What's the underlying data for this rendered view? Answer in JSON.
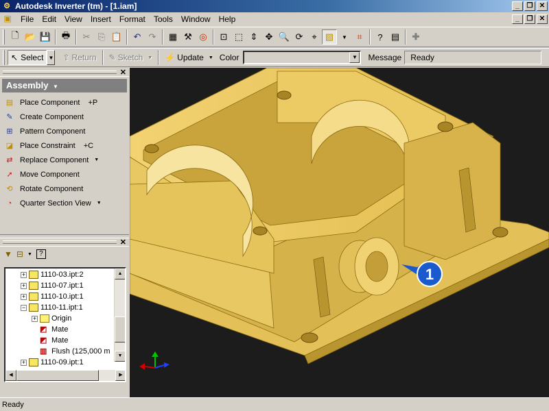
{
  "window": {
    "title": "Autodesk Inverter (tm) - [1.iam]",
    "min": "_",
    "max": "❐",
    "close": "✕"
  },
  "menu": [
    "File",
    "Edit",
    "View",
    "Insert",
    "Format",
    "Tools",
    "Window",
    "Help"
  ],
  "toolbar2": {
    "select": "Select",
    "return": "Return",
    "sketch": "Sketch",
    "update": "Update",
    "color_label": "Color",
    "color_value": "",
    "message_label": "Message",
    "message_value": "Ready"
  },
  "assembly_panel": {
    "title": "Assembly",
    "commands": [
      {
        "label": "Place Component",
        "shortcut": "+P"
      },
      {
        "label": "Create Component",
        "shortcut": ""
      },
      {
        "label": "Pattern Component",
        "shortcut": ""
      },
      {
        "label": "Place Constraint",
        "shortcut": "+C"
      },
      {
        "label": "Replace Component",
        "shortcut": ""
      },
      {
        "label": "Move Component",
        "shortcut": ""
      },
      {
        "label": "Rotate Component",
        "shortcut": ""
      },
      {
        "label": "Quarter Section View",
        "shortcut": ""
      }
    ]
  },
  "browser": {
    "tree": [
      {
        "label": "1110-03.ipt:2",
        "level": 0,
        "expander": "+",
        "icon": "part"
      },
      {
        "label": "1110-07.ipt:1",
        "level": 0,
        "expander": "+",
        "icon": "part"
      },
      {
        "label": "1110-10.ipt:1",
        "level": 0,
        "expander": "+",
        "icon": "part"
      },
      {
        "label": "1110-11.ipt:1",
        "level": 0,
        "expander": "−",
        "icon": "part"
      },
      {
        "label": "Origin",
        "level": 1,
        "expander": "+",
        "icon": "folder"
      },
      {
        "label": "Mate",
        "level": 1,
        "expander": "",
        "icon": "mate"
      },
      {
        "label": "Mate",
        "level": 1,
        "expander": "",
        "icon": "mate"
      },
      {
        "label": "Flush (125,000 m",
        "level": 1,
        "expander": "",
        "icon": "flush"
      },
      {
        "label": "1110-09.ipt:1",
        "level": 0,
        "expander": "+",
        "icon": "part"
      }
    ]
  },
  "viewport": {
    "callout": "1",
    "model_color": "#e8c45c",
    "background": "#1c1c1c"
  },
  "status": "Ready"
}
